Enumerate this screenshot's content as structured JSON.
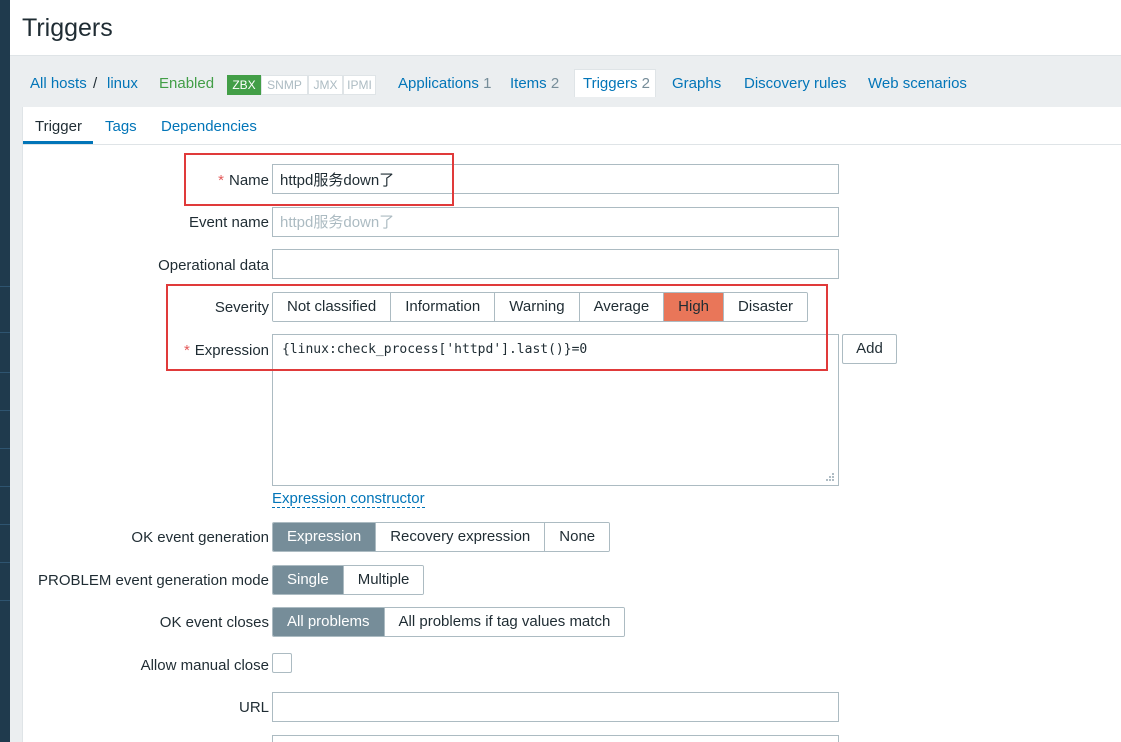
{
  "page": {
    "title": "Triggers"
  },
  "host_nav": {
    "all_hosts": "All hosts",
    "separator": "/",
    "host": "linux",
    "status": "Enabled",
    "availability": [
      "ZBX",
      "SNMP",
      "JMX",
      "IPMI"
    ],
    "applications": {
      "label": "Applications",
      "count": "1"
    },
    "items": {
      "label": "Items",
      "count": "2"
    },
    "triggers": {
      "label": "Triggers",
      "count": "2"
    },
    "graphs": "Graphs",
    "discovery_rules": "Discovery rules",
    "web_scenarios": "Web scenarios"
  },
  "subtabs": {
    "trigger": "Trigger",
    "tags": "Tags",
    "dependencies": "Dependencies"
  },
  "form": {
    "name": {
      "label": "Name",
      "required": "*",
      "value": "httpd服务down了"
    },
    "event_name": {
      "label": "Event name",
      "placeholder": "httpd服务down了"
    },
    "operational_data": {
      "label": "Operational data",
      "value": ""
    },
    "severity": {
      "label": "Severity",
      "options": [
        "Not classified",
        "Information",
        "Warning",
        "Average",
        "High",
        "Disaster"
      ],
      "selected": "High"
    },
    "expression": {
      "label": "Expression",
      "required": "*",
      "value": "{linux:check_process['httpd'].last()}=0",
      "add_button": "Add",
      "constructor_link": "Expression constructor"
    },
    "ok_event_generation": {
      "label": "OK event generation",
      "options": [
        "Expression",
        "Recovery expression",
        "None"
      ],
      "selected": "Expression"
    },
    "problem_mode": {
      "label": "PROBLEM event generation mode",
      "options": [
        "Single",
        "Multiple"
      ],
      "selected": "Single"
    },
    "ok_event_closes": {
      "label": "OK event closes",
      "options": [
        "All problems",
        "All problems if tag values match"
      ],
      "selected": "All problems"
    },
    "allow_manual_close": {
      "label": "Allow manual close",
      "checked": false
    },
    "url": {
      "label": "URL",
      "value": ""
    }
  },
  "colors": {
    "link": "#0275b8",
    "enabled": "#429e47",
    "severity_high": "#e97659",
    "selected_segment": "#768d99",
    "required": "#e45959",
    "annotation": "#e03a3a"
  }
}
